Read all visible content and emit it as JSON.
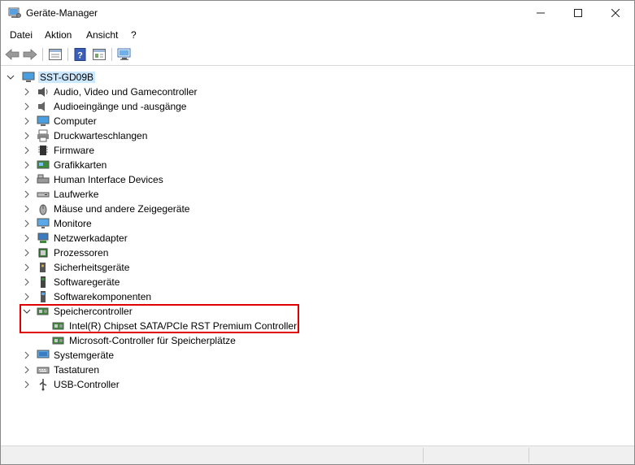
{
  "window": {
    "title": "Geräte-Manager",
    "controls": {
      "minimize": "—",
      "maximize": "☐",
      "close": "✕"
    }
  },
  "menubar": {
    "items": [
      "Datei",
      "Aktion",
      "Ansicht",
      "?"
    ]
  },
  "toolbar": {
    "buttons": [
      "back-icon",
      "forward-icon",
      "properties-icon",
      "help-icon",
      "view-icon",
      "monitor-scan-icon"
    ]
  },
  "tree": {
    "root": "SST-GD09B",
    "categories": [
      "Audio, Video und Gamecontroller",
      "Audioeingänge und -ausgänge",
      "Computer",
      "Druckwarteschlangen",
      "Firmware",
      "Grafikkarten",
      "Human Interface Devices",
      "Laufwerke",
      "Mäuse und andere Zeigegeräte",
      "Monitore",
      "Netzwerkadapter",
      "Prozessoren",
      "Sicherheitsgeräte",
      "Softwaregeräte",
      "Softwarekomponenten",
      "Speichercontroller",
      "Systemgeräte",
      "Tastaturen",
      "USB-Controller"
    ],
    "expanded_category": "Speichercontroller",
    "storage_children": [
      "Intel(R) Chipset SATA/PCIe RST Premium Controller",
      "Microsoft-Controller für Speicherplätze"
    ]
  },
  "colors": {
    "root_selection": "#cce8ff",
    "highlight_border": "#e00000"
  }
}
